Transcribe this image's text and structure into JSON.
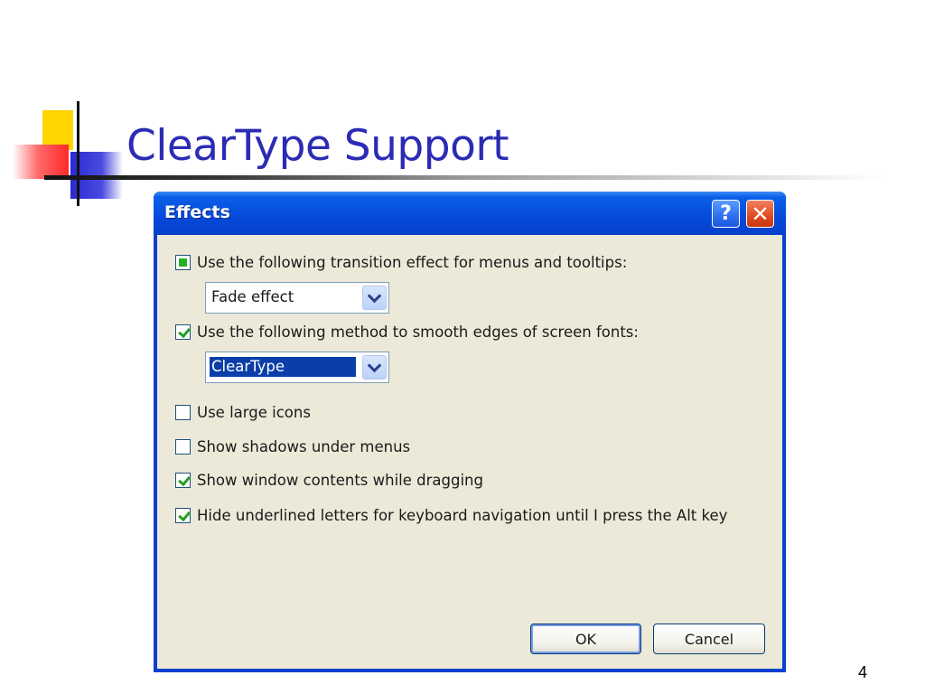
{
  "slide": {
    "title": "ClearType Support",
    "page_number": "4"
  },
  "dialog": {
    "title": "Effects",
    "help_button_label": "?",
    "close_button_label": "✕",
    "options": [
      {
        "label": "Use the following transition effect for menus and tooltips:",
        "state": "indeterminate"
      },
      {
        "label": "Use the following method to smooth edges of screen fonts:",
        "state": "checked"
      },
      {
        "label": "Use large icons",
        "state": "unchecked"
      },
      {
        "label": "Show shadows under menus",
        "state": "unchecked"
      },
      {
        "label": "Show window contents while dragging",
        "state": "checked"
      },
      {
        "label": "Hide underlined letters for keyboard navigation until I press the Alt key",
        "state": "checked"
      }
    ],
    "transition_effect": {
      "value": "Fade effect"
    },
    "smoothing_method": {
      "value": "ClearType"
    },
    "ok_label": "OK",
    "cancel_label": "Cancel"
  },
  "colors": {
    "title_text": "#2b2bb5",
    "titlebar": "#0648d8",
    "dialog_face": "#ece9d8",
    "checkmark": "#21a121"
  }
}
